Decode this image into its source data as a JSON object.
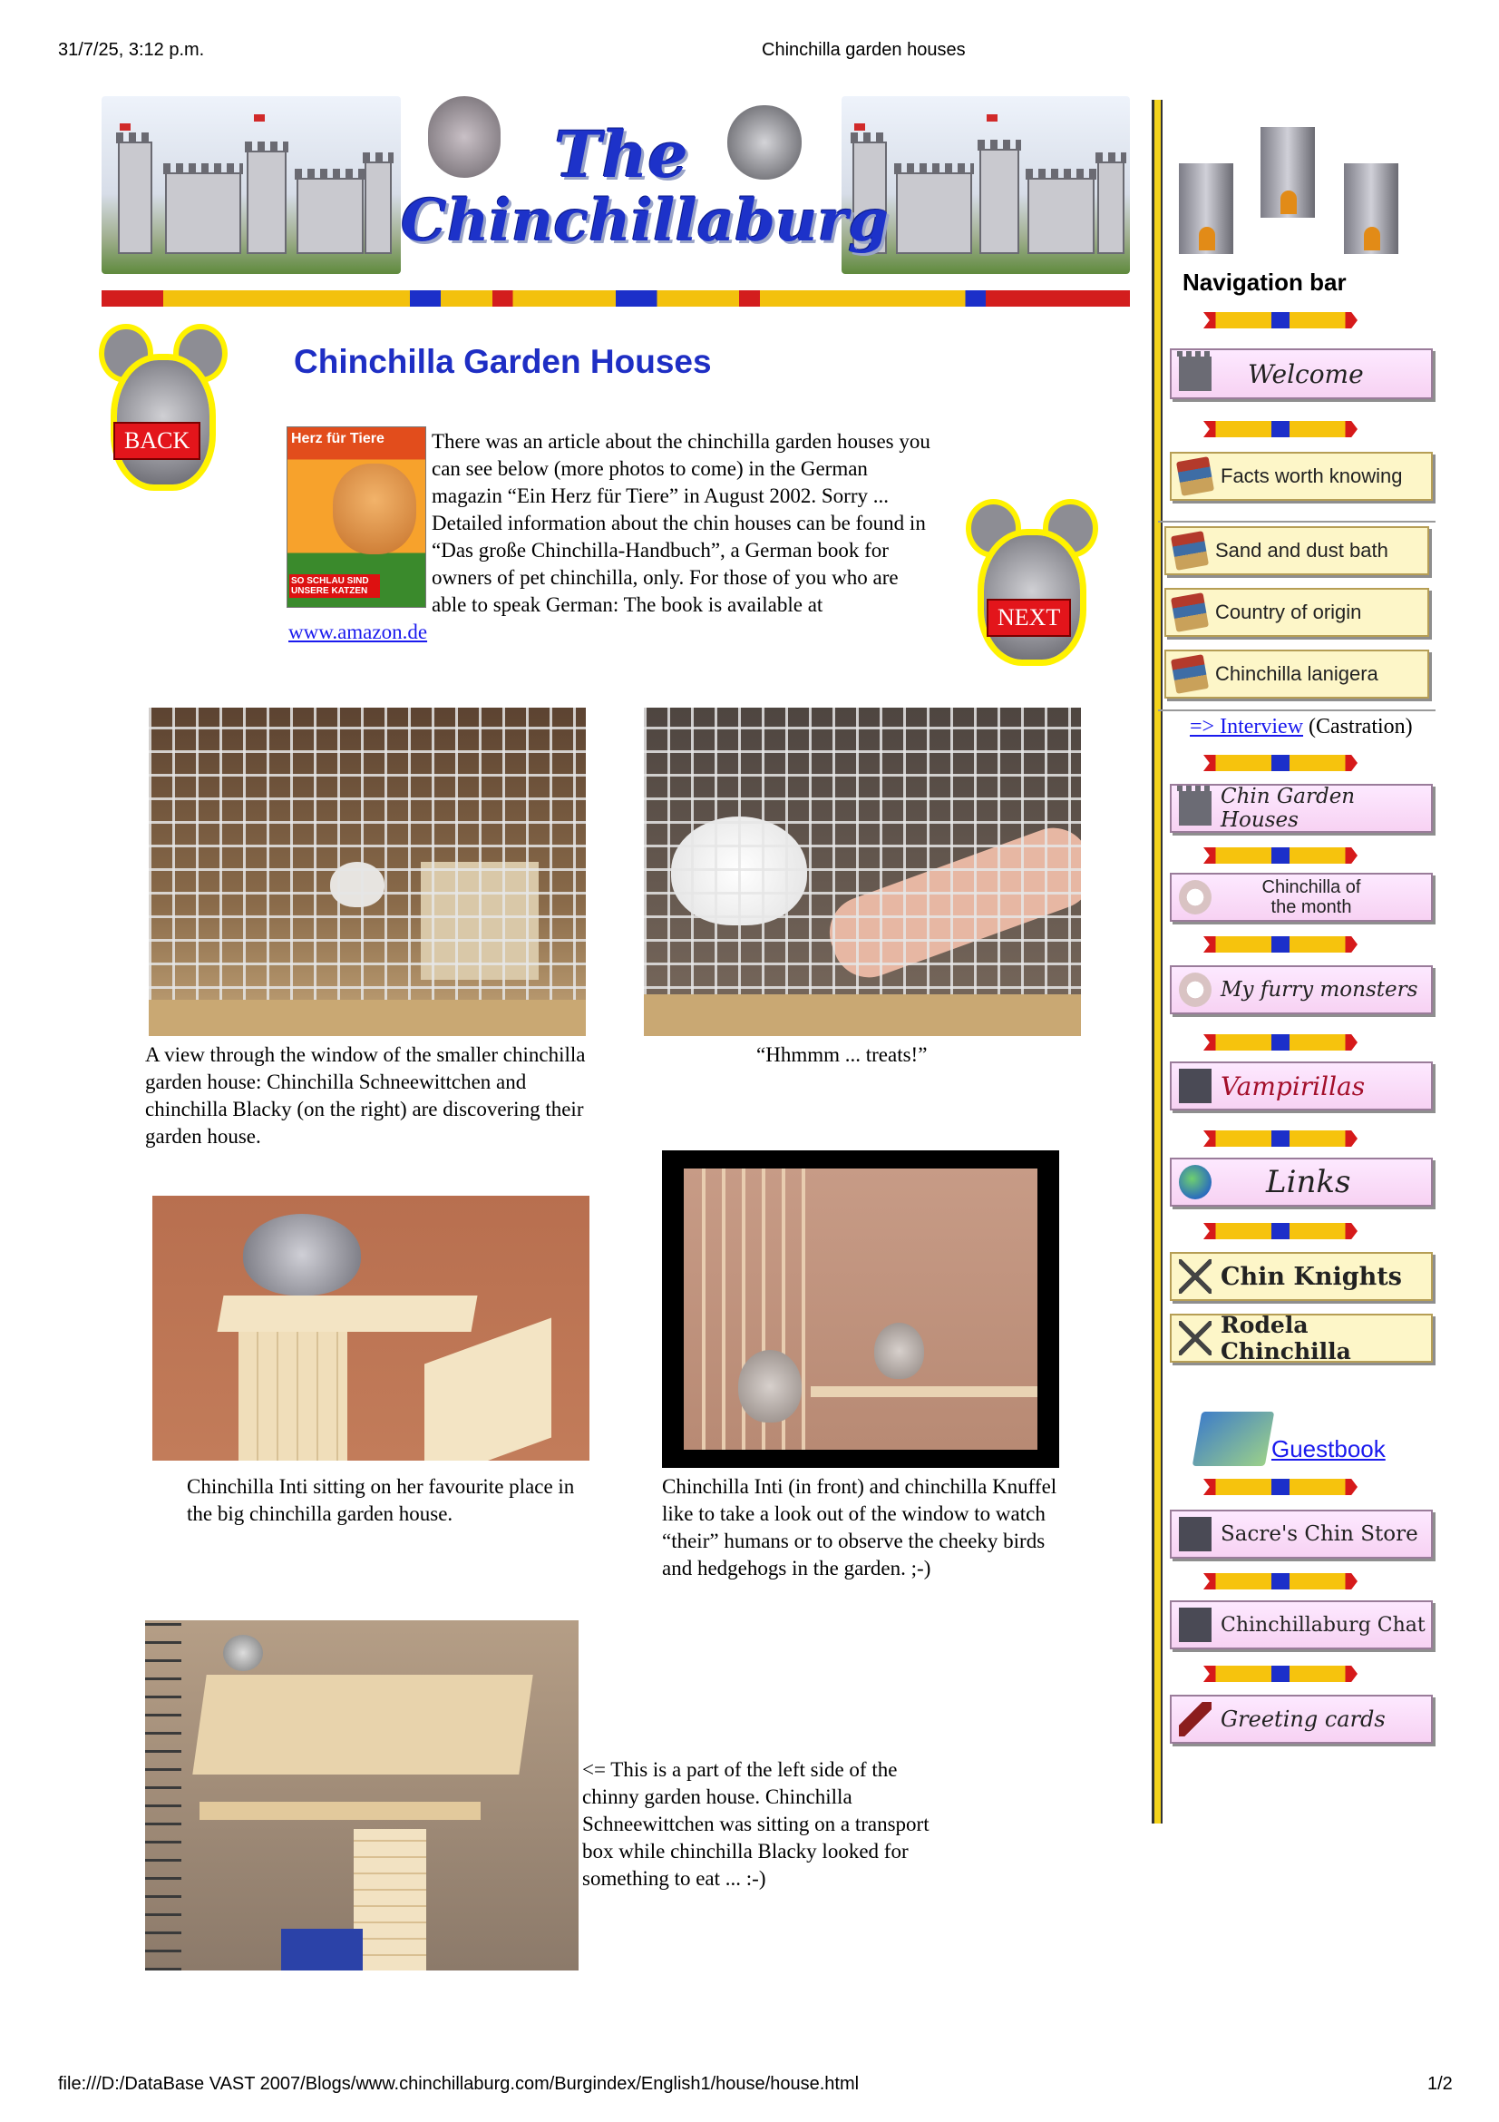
{
  "print_header": {
    "datetime": "31/7/25, 3:12 p.m.",
    "doc_title": "Chinchilla garden houses"
  },
  "banner": {
    "logo_line1": "The",
    "logo_line2": "Chinchillaburg"
  },
  "back_button": "BACK",
  "next_button": "NEXT",
  "page_title": "Chinchilla Garden Houses",
  "magazine_cover": {
    "masthead": "Herz für Tiere",
    "headline": "SO SCHLAU SIND UNSERE KATZEN"
  },
  "intro": {
    "text_before_link": "There was an article about the chinchilla garden houses you can see below (more photos to come) in the German magazin “Ein Herz für Tiere” in August 2002. Sorry ... Detailed information about the chin houses can be found in “Das große Chinchilla-Handbuch”, a German book for owners of pet chinchilla, only.  For those of you who are able to speak German: The book is available at",
    "link_text": "www.amazon.de"
  },
  "captions": {
    "photo1": "A view through the window of the smaller chinchilla garden house: Chinchilla Schneewittchen and chinchilla Blacky (on the right) are discovering their garden house.",
    "photo2": "“Hhmmm ... treats!”",
    "photo3": "Chinchilla Inti sitting on her favourite place in the big chinchilla garden house.",
    "photo4": "Chinchilla Inti (in front) and chinchilla Knuffel  like to take a look out of the window to watch “their” humans or to observe the cheeky birds and hedgehogs in the garden. ;-)",
    "photo5": "<= This is a part of the left side of the chinny garden house. Chinchilla Schneewittchen was sitting on a transport box while chinchilla Blacky looked for something to eat ... :-)"
  },
  "sidebar": {
    "heading": "Navigation bar",
    "welcome": "Welcome",
    "facts": "Facts worth knowing",
    "sand": "Sand and dust bath",
    "country": "Country of origin",
    "lanigera": "Chinchilla lanigera",
    "interview_link": "=> Interview",
    "interview_note": "(Castration)",
    "garden_houses": "Chin Garden Houses",
    "chin_month_1": "Chinchilla of",
    "chin_month_2": "the month",
    "furry": "My furry monsters",
    "vampirillas": "Vampirillas",
    "links": "Links",
    "knights": "Chin Knights",
    "rodela": "Rodela Chinchilla",
    "guestbook": "Guestbook",
    "store": "Sacre's Chin Store",
    "chat": "Chinchillaburg Chat",
    "greeting": "Greeting cards"
  },
  "footer": {
    "path": "file:///D:/DataBase VAST 2007/Blogs/www.chinchillaburg.com/Burgindex/English1/house/house.html",
    "page": "1/2"
  }
}
